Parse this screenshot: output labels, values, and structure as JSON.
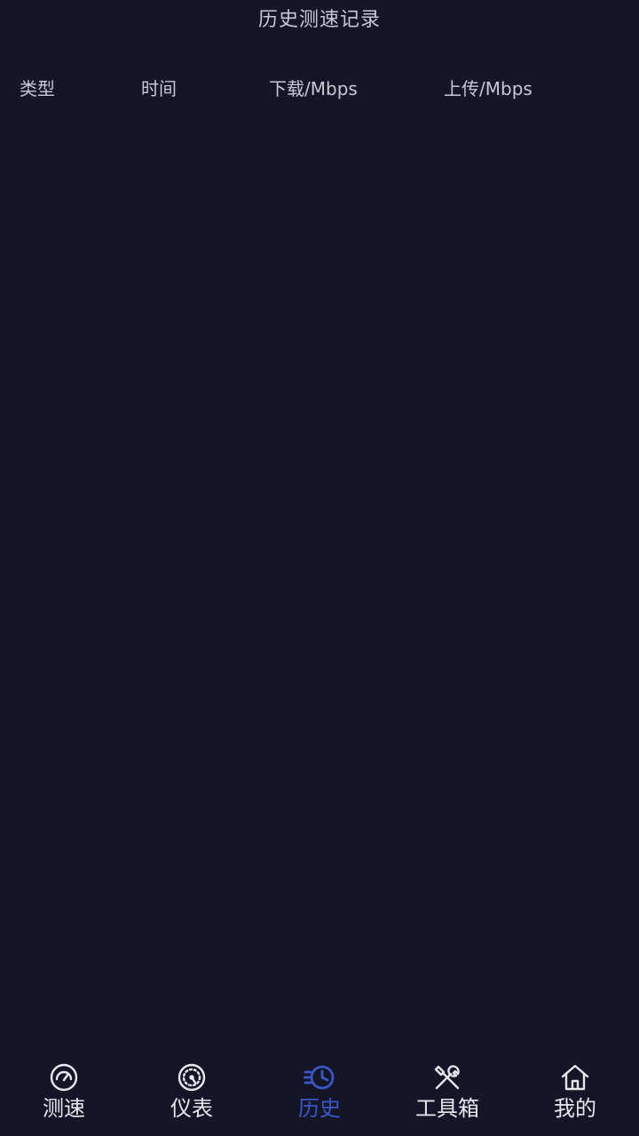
{
  "header": {
    "title": "历史测速记录"
  },
  "table": {
    "columns": [
      "类型",
      "时间",
      "下载/Mbps",
      "上传/Mbps"
    ],
    "rows": []
  },
  "bottom_nav": {
    "items": [
      {
        "label": "测速",
        "icon": "speedometer-icon",
        "active": false
      },
      {
        "label": "仪表",
        "icon": "gauge-icon",
        "active": false
      },
      {
        "label": "历史",
        "icon": "history-clock-icon",
        "active": true
      },
      {
        "label": "工具箱",
        "icon": "tools-icon",
        "active": false
      },
      {
        "label": "我的",
        "icon": "home-icon",
        "active": false
      }
    ],
    "active_color": "#3a57c8",
    "inactive_color": "#e7e8ee"
  },
  "theme": {
    "background": "#141627",
    "text": "#c6c9d4"
  }
}
